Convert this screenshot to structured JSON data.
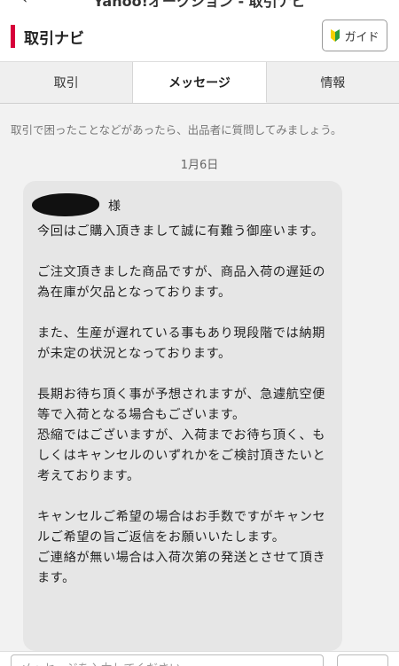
{
  "topbar": {
    "back_glyph": "‹",
    "title": "Yahoo!オークション - 取引ナビ"
  },
  "header": {
    "title": "取引ナビ",
    "guide_label": "ガイド",
    "guide_icon": "beginner-leaf-icon",
    "accent_color": "#d7003a"
  },
  "tabs": [
    {
      "label": "取引",
      "active": false
    },
    {
      "label": "メッセージ",
      "active": true
    },
    {
      "label": "情報",
      "active": false
    }
  ],
  "hint": "取引で困ったことなどがあったら、出品者に質問してみましょう。",
  "date": "1月6日",
  "message": {
    "honorific": "様",
    "paragraphs": [
      "今回はご購入頂きまして誠に有難う御座います。",
      "ご注文頂きました商品ですが、商品入荷の遅延の為在庫が欠品となっております。",
      "また、生産が遅れている事もあり現段階では納期が未定の状況となっております。",
      "長期お待ち頂く事が予想されますが、急遽航空便等で入荷となる場合もございます。\n恐縮ではございますが、入荷までお待ち頂く、もしくはキャンセルのいずれかをご検討頂きたいと考えております。",
      "キャンセルご希望の場合はお手数ですがキャンセルご希望の旨ご返信をお願いいたします。\nご連絡が無い場合は入荷次第の発送とさせて頂きます。"
    ]
  },
  "reply": {
    "placeholder": "メッセージを入力してください"
  }
}
